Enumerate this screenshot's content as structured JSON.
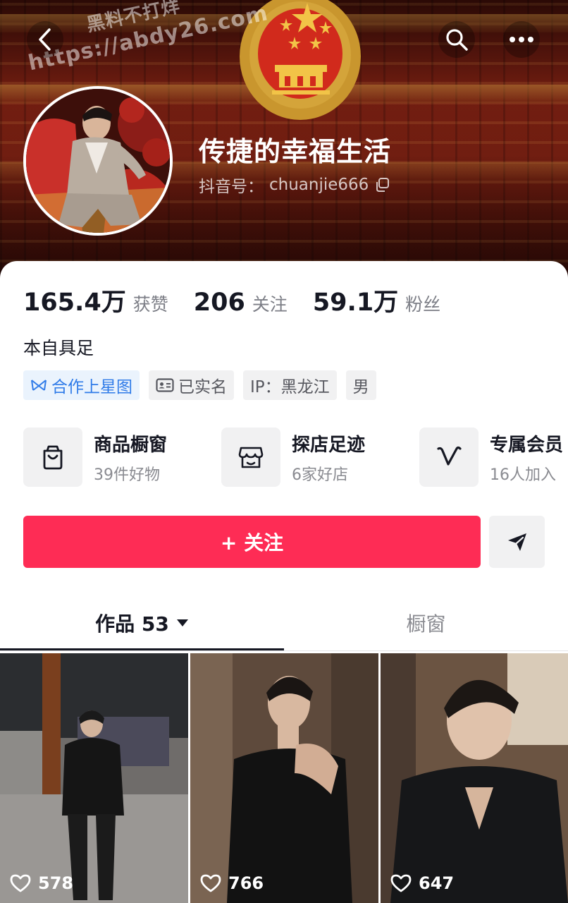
{
  "header": {
    "watermark_line1": "黑料不打烊",
    "watermark_line2": "https://abdy26.com",
    "icons": {
      "back": "chevron-left-icon",
      "search": "search-icon",
      "more": "more-dots-icon"
    }
  },
  "profile": {
    "nickname": "传捷的幸福生活",
    "douyin_id_label": "抖音号：",
    "douyin_id": "chuanjie666",
    "bio": "本自具足"
  },
  "stats": [
    {
      "value": "165.4万",
      "label": "获赞"
    },
    {
      "value": "206",
      "label": "关注"
    },
    {
      "value": "59.1万",
      "label": "粉丝"
    }
  ],
  "tags": [
    {
      "text": "合作上星图",
      "icon": "star-map-icon"
    },
    {
      "text": "已实名",
      "icon": "id-card-icon"
    },
    {
      "text": "IP：黑龙江"
    },
    {
      "text": "男"
    }
  ],
  "features": [
    {
      "title": "商品橱窗",
      "subtitle": "39件好物",
      "icon": "shopping-bag-icon"
    },
    {
      "title": "探店足迹",
      "subtitle": "6家好店",
      "icon": "store-icon"
    },
    {
      "title": "专属会员",
      "subtitle": "16人加入",
      "icon": "v-badge-icon"
    }
  ],
  "actions": {
    "follow": "+ 关注",
    "share_icon": "send-icon"
  },
  "tabs": [
    {
      "label": "作品 53",
      "active": true
    },
    {
      "label": "橱窗",
      "active": false
    }
  ],
  "videos": [
    {
      "likes": "578"
    },
    {
      "likes": "766"
    },
    {
      "likes": "647"
    }
  ],
  "colors": {
    "accent": "#fe2c55",
    "link_blue": "#2f7be8",
    "text": "#161823",
    "muted": "#8a8b91"
  }
}
